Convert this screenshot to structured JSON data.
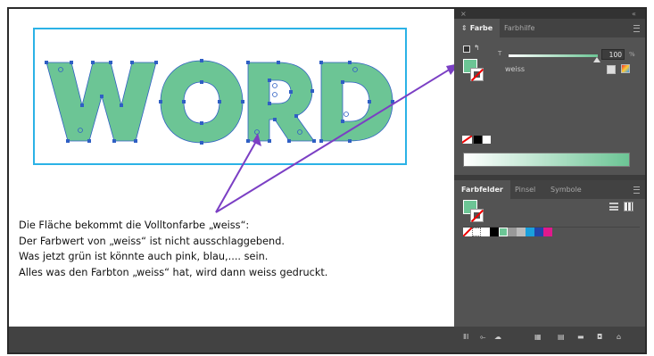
{
  "caption": {
    "line1": "Die Fläche bekommt die Volltonfarbe „weiss“:",
    "line2": "Der Farbwert von „weiss“ ist nicht ausschlaggebend.",
    "line3": "Was jetzt grün ist könnte auch pink, blau,.... sein.",
    "line4": "Alles was den Farbton „weiss“ hat, wird dann weiss gedruckt."
  },
  "artwork": {
    "text": "WORD",
    "fill_color": "#6cc595",
    "selection_color": "#2bb2e6",
    "anchor_color": "#2f5fc4",
    "arrow_color": "#7b3fc4"
  },
  "color_panel": {
    "close_glyph": "×",
    "collapse_glyph": "«",
    "tab_color": "Farbe",
    "tab_guide": "Farbhilfe",
    "tint_label": "T",
    "tint_value": "100",
    "tint_unit": "%",
    "swatch_name": "weiss",
    "tint_percent": 100
  },
  "swatches_panel": {
    "tab_swatches": "Farbfelder",
    "tab_brushes": "Pinsel",
    "tab_symbols": "Symbole"
  },
  "icons": [
    "menu-icon",
    "swap-icon",
    "list-view-icon",
    "grid-view-icon",
    "library-icon",
    "swatch-options-icon",
    "cloud-icon",
    "folder-icon",
    "new-swatch-icon",
    "trash-icon"
  ]
}
